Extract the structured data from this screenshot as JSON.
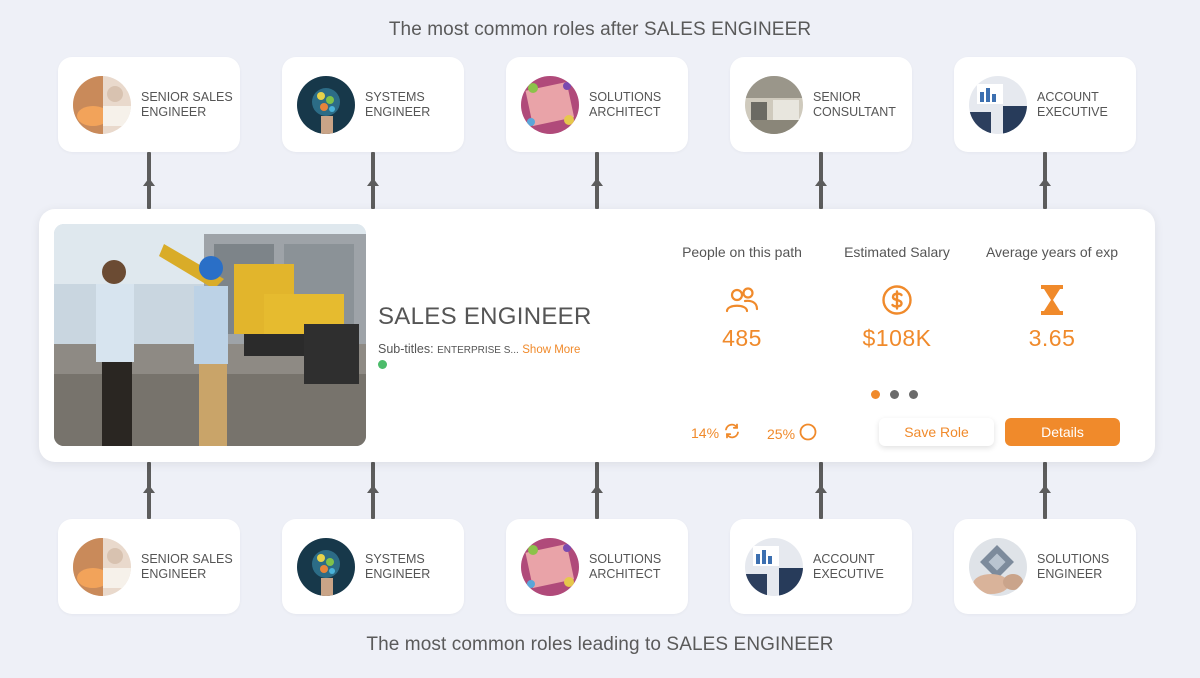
{
  "headings": {
    "top": "The most common roles after SALES ENGINEER",
    "bottom": "The most common roles leading to SALES ENGINEER"
  },
  "top_roles": [
    {
      "label": "SENIOR SALES ENGINEER",
      "avatar": "handshake-photo"
    },
    {
      "label": "SYSTEMS ENGINEER",
      "avatar": "network-hand-photo"
    },
    {
      "label": "SOLUTIONS ARCHITECT",
      "avatar": "blueprint-photo"
    },
    {
      "label": "SENIOR CONSULTANT",
      "avatar": "office-photo"
    },
    {
      "label": "ACCOUNT EXECUTIVE",
      "avatar": "charts-desk-photo"
    }
  ],
  "bottom_roles": [
    {
      "label": "SENIOR SALES ENGINEER",
      "avatar": "handshake-photo"
    },
    {
      "label": "SYSTEMS ENGINEER",
      "avatar": "network-hand-photo"
    },
    {
      "label": "SOLUTIONS ARCHITECT",
      "avatar": "blueprint-photo"
    },
    {
      "label": "ACCOUNT EXECUTIVE",
      "avatar": "charts-desk-photo"
    },
    {
      "label": "SOLUTIONS ENGINEER",
      "avatar": "puzzle-hand-photo"
    }
  ],
  "main": {
    "title": "SALES ENGINEER",
    "subtitles_label": "Sub-titles:",
    "subtitles_value": "ENTERPRISE S...",
    "show_more": "Show More",
    "photo": "construction-site-photo",
    "stats": [
      {
        "label": "People on this path",
        "value": "485",
        "icon": "people-icon"
      },
      {
        "label": "Estimated Salary",
        "value": "$108K",
        "icon": "dollar-icon"
      },
      {
        "label": "Average years of exp",
        "value": "3.65",
        "icon": "hourglass-icon"
      }
    ],
    "pager": {
      "count": 3,
      "active": 0
    },
    "pct_1": "14%",
    "pct_2": "25%",
    "save_label": "Save Role",
    "details_label": "Details"
  },
  "colors": {
    "accent": "#f08a2b",
    "background": "#eef0f7",
    "status_green": "#4cbc6b",
    "connector": "#5c5c5c"
  }
}
